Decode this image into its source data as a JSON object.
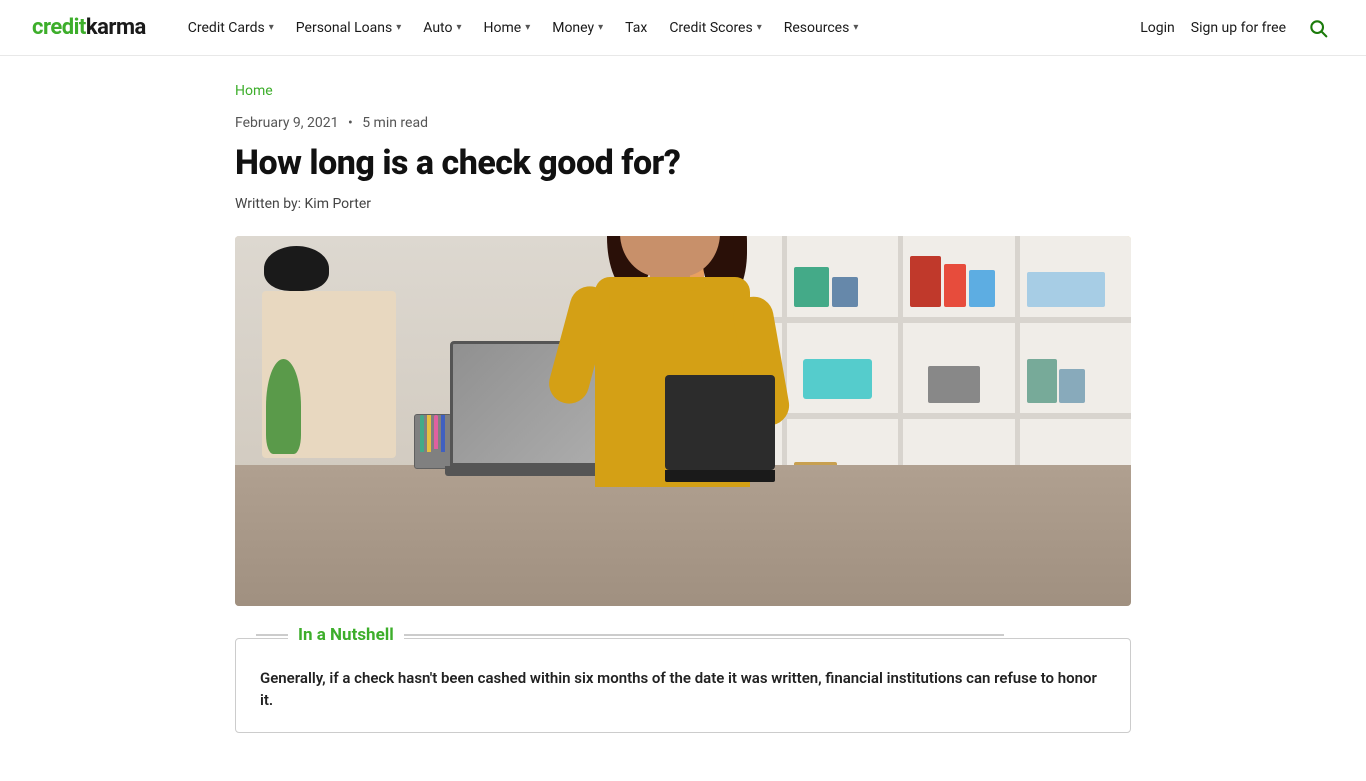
{
  "brand": {
    "name_part1": "credit",
    "name_part2": "karma",
    "color": "#3dae2b"
  },
  "nav": {
    "items": [
      {
        "label": "Credit Cards",
        "has_dropdown": true
      },
      {
        "label": "Personal Loans",
        "has_dropdown": true
      },
      {
        "label": "Auto",
        "has_dropdown": true
      },
      {
        "label": "Home",
        "has_dropdown": true
      },
      {
        "label": "Money",
        "has_dropdown": true
      },
      {
        "label": "Tax",
        "has_dropdown": false
      },
      {
        "label": "Credit Scores",
        "has_dropdown": true
      },
      {
        "label": "Resources",
        "has_dropdown": true
      }
    ],
    "login_label": "Login",
    "signup_label": "Sign up for free"
  },
  "breadcrumb": {
    "home_label": "Home"
  },
  "article": {
    "date": "February 9, 2021",
    "separator": "•",
    "read_time": "5 min read",
    "title": "How long is a check good for?",
    "author_prefix": "Written by:",
    "author_name": "Kim Porter"
  },
  "nutshell": {
    "heading": "In a Nutshell",
    "body": "Generally, if a check hasn't been cashed within six months of the date it was written, financial institutions can refuse to honor it."
  }
}
